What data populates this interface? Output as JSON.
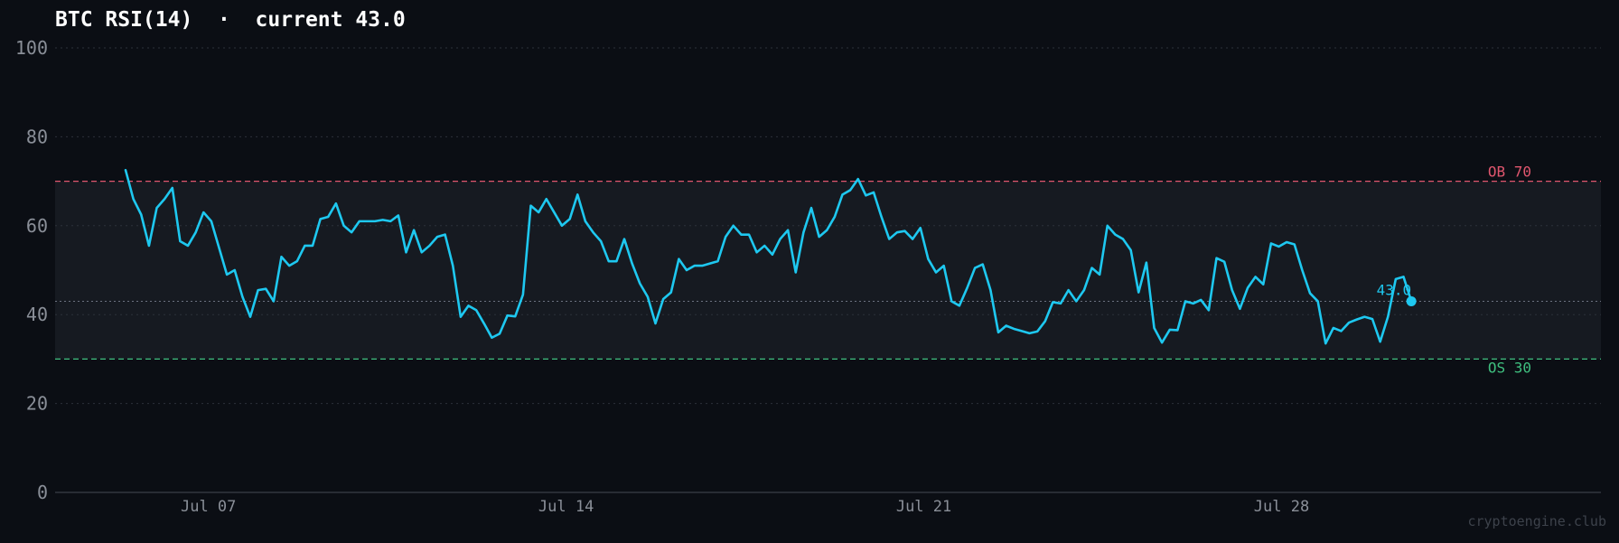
{
  "title": "BTC RSI(14)  ·  current 43.0",
  "watermark": "cryptoengine.club",
  "colors": {
    "background": "#0b0e14",
    "line": "#1ec8f0",
    "overbought": "#e0566e",
    "oversold": "#3fbf7f",
    "band_fill": "#161a21",
    "grid": "#2c313a",
    "current_line": "#6b7280"
  },
  "chart_data": {
    "type": "line",
    "title": "BTC RSI(14)  ·  current 43.0",
    "xlabel": "",
    "ylabel": "",
    "ylim": [
      0,
      100
    ],
    "yticks": [
      0,
      20,
      40,
      60,
      80,
      100
    ],
    "grid": true,
    "xticks": [
      {
        "x": 3,
        "label": "Jul 07"
      },
      {
        "x": 10,
        "label": "Jul 14"
      },
      {
        "x": 17,
        "label": "Jul 21"
      },
      {
        "x": 24,
        "label": "Jul 28"
      }
    ],
    "x_range": [
      0,
      30.25
    ],
    "overbought": {
      "value": 70,
      "label": "OB 70"
    },
    "oversold": {
      "value": 30,
      "label": "OS 30"
    },
    "current": {
      "value": 43.0,
      "label": "43.0"
    },
    "series": [
      {
        "values": [
          72.5,
          66,
          62.5,
          55.5,
          64,
          66,
          68.5,
          56.5,
          55.5,
          58.5,
          63,
          61,
          55,
          49,
          50,
          44,
          39.5,
          45.5,
          45.8,
          43,
          53,
          51,
          52,
          55.5,
          55.5,
          61.5,
          62,
          65,
          60,
          58.5,
          61,
          61,
          61,
          61.3,
          61,
          62.3,
          54,
          59,
          54,
          55.5,
          57.5,
          58,
          51,
          39.5,
          42,
          41,
          38,
          34.8,
          35.7,
          39.8,
          39.6,
          44.5,
          64.5,
          63,
          66,
          63,
          60,
          61.5,
          67,
          61,
          58.5,
          56.5,
          52,
          52,
          57,
          51.5,
          47,
          44,
          38,
          43.5,
          45,
          52.5,
          50,
          51,
          51,
          51.5,
          52,
          57.5,
          60,
          58,
          58,
          54,
          55.5,
          53.5,
          57,
          59,
          49.5,
          58.5,
          64,
          57.5,
          59,
          62,
          67,
          68,
          70.5,
          66.8,
          67.5,
          62,
          57,
          58.5,
          58.8,
          57,
          59.5,
          52.5,
          49.5,
          51,
          43,
          42,
          46,
          50.5,
          51.3,
          45.5,
          36,
          37.5,
          36.8,
          36.3,
          35.8,
          36.2,
          38.5,
          42.8,
          42.5,
          45.5,
          43,
          45.5,
          50.5,
          49,
          60,
          58,
          57,
          54.5,
          45,
          51.7,
          37,
          33.7,
          36.6,
          36.5,
          43,
          42.5,
          43.3,
          41,
          52.7,
          51.9,
          45.5,
          41.3,
          46,
          48.5,
          46.8,
          56,
          55.3,
          56.3,
          55.8,
          50,
          44.8,
          43,
          33.5,
          37,
          36.3,
          38.2,
          38.9,
          39.5,
          39,
          33.9,
          39.5,
          48,
          48.5,
          43.0
        ]
      }
    ]
  }
}
